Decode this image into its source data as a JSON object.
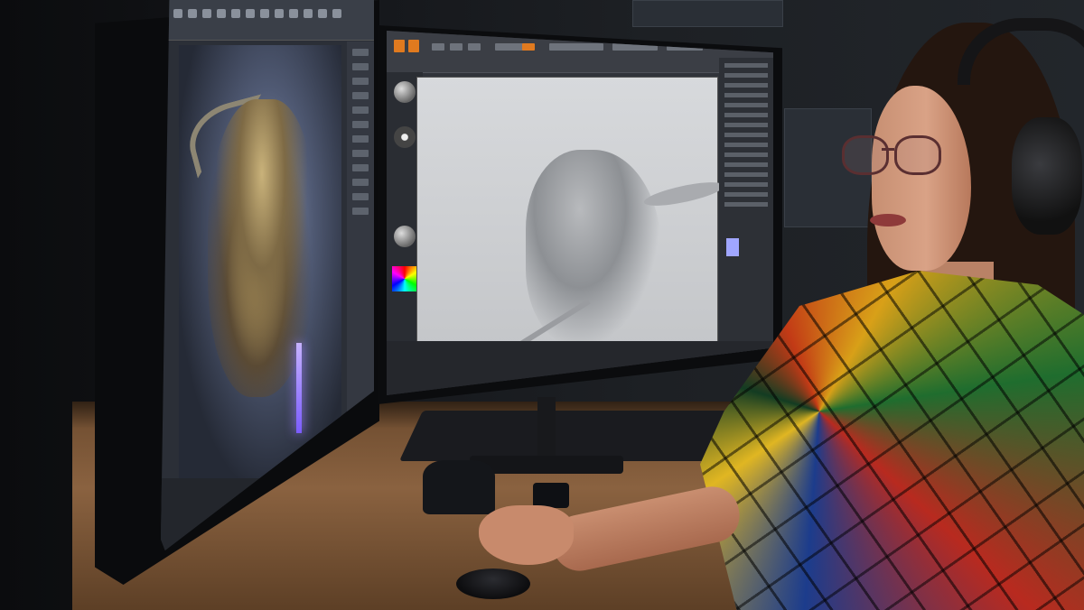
{
  "scene": {
    "type": "photograph",
    "subject": "person-at-dual-monitor-workstation"
  },
  "colors": {
    "accent": "#e07a1f",
    "background": "#0f1114",
    "desk": "#7a5536"
  }
}
